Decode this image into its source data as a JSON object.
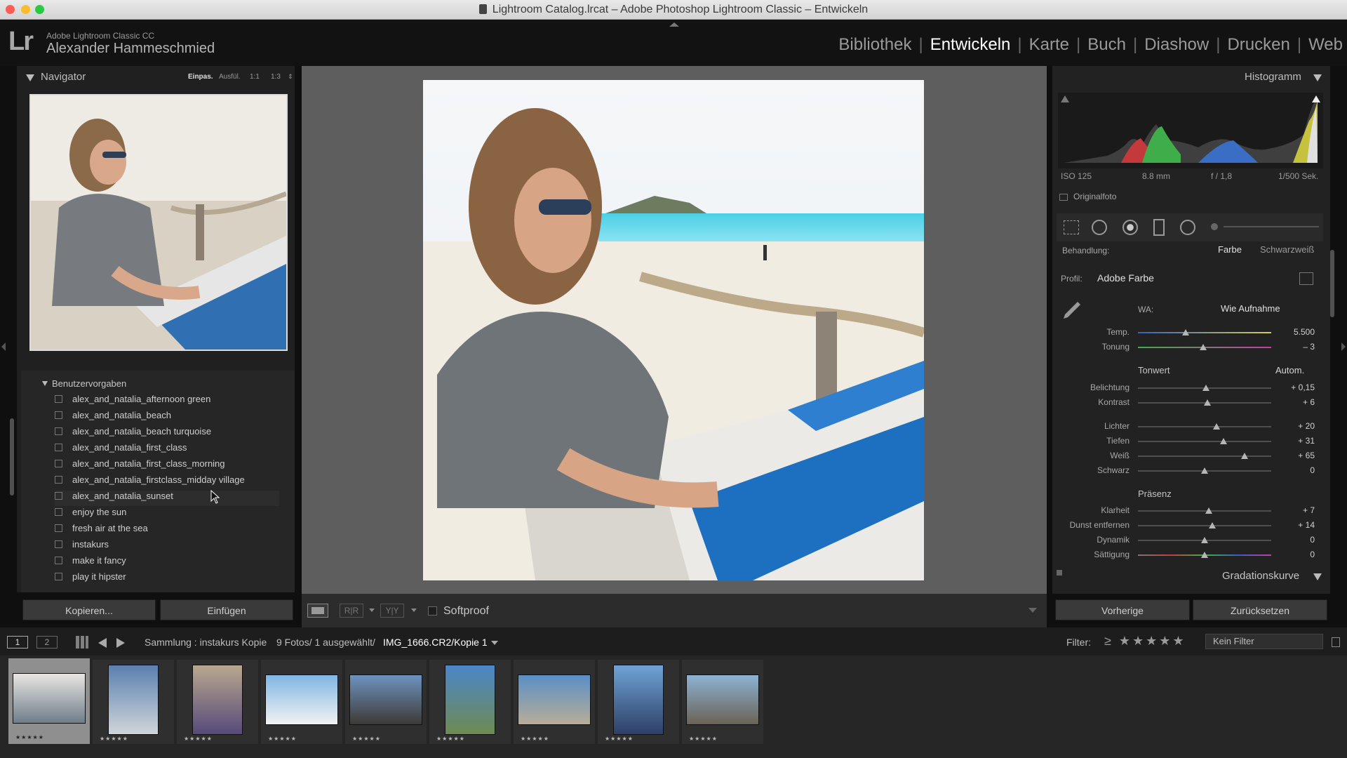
{
  "window": {
    "title": "Lightroom Catalog.lrcat – Adobe Photoshop Lightroom Classic – Entwickeln",
    "colors": {
      "close": "#fd5c58",
      "minimize": "#fdbc2e",
      "zoom": "#29c940"
    }
  },
  "identity": {
    "logo": "Lr",
    "product": "Adobe Lightroom Classic CC",
    "user": "Alexander Hammeschmied"
  },
  "modules": [
    {
      "label": "Bibliothek",
      "active": false
    },
    {
      "label": "Entwickeln",
      "active": true
    },
    {
      "label": "Karte",
      "active": false
    },
    {
      "label": "Buch",
      "active": false
    },
    {
      "label": "Diashow",
      "active": false
    },
    {
      "label": "Drucken",
      "active": false
    },
    {
      "label": "Web",
      "active": false
    }
  ],
  "navigator": {
    "title": "Navigator",
    "zoom_options": [
      "Einpas.",
      "Ausfül.",
      "1:1",
      "1:3"
    ]
  },
  "presets": {
    "group": "Benutzervorgaben",
    "items": [
      "alex_and_natalia_afternoon green",
      "alex_and_natalia_beach",
      "alex_and_natalia_beach turquoise",
      "alex_and_natalia_first_class",
      "alex_and_natalia_first_class_morning",
      "alex_and_natalia_firstclass_midday village",
      "alex_and_natalia_sunset",
      "enjoy the sun",
      "fresh air at the sea",
      "instakurs",
      "make it fancy",
      "play it hipster"
    ]
  },
  "left_buttons": {
    "copy": "Kopieren...",
    "paste": "Einfügen"
  },
  "toolbar": {
    "softproof": "Softproof"
  },
  "histogram": {
    "title": "Histogramm",
    "iso": "ISO 125",
    "focal": "8.8 mm",
    "aperture": "f / 1,8",
    "shutter": "1/500 Sek.",
    "original": "Originalfoto"
  },
  "basic": {
    "treatment_label": "Behandlung:",
    "treatment_color": "Farbe",
    "treatment_bw": "Schwarzweiß",
    "profile_label": "Profil:",
    "profile_value": "Adobe Farbe",
    "wb_label": "WA:",
    "wb_value": "Wie Aufnahme",
    "tonwert": "Tonwert",
    "auto": "Autom.",
    "praesenz": "Präsenz",
    "sliders": [
      {
        "label": "Temp.",
        "value": "5.500",
        "pos": 0.36
      },
      {
        "label": "Tonung",
        "value": "– 3",
        "pos": 0.49
      },
      {
        "label": "Belichtung",
        "value": "+ 0,15",
        "pos": 0.51
      },
      {
        "label": "Kontrast",
        "value": "+ 6",
        "pos": 0.52
      },
      {
        "label": "Lichter",
        "value": "+ 20",
        "pos": 0.59
      },
      {
        "label": "Tiefen",
        "value": "+ 31",
        "pos": 0.64
      },
      {
        "label": "Weiß",
        "value": "+ 65",
        "pos": 0.8
      },
      {
        "label": "Schwarz",
        "value": "0",
        "pos": 0.5
      },
      {
        "label": "Klarheit",
        "value": "+ 7",
        "pos": 0.53
      },
      {
        "label": "Dunst entfernen",
        "value": "+ 14",
        "pos": 0.56
      },
      {
        "label": "Dynamik",
        "value": "0",
        "pos": 0.5
      },
      {
        "label": "Sättigung",
        "value": "0",
        "pos": 0.5
      }
    ],
    "curve": "Gradationskurve"
  },
  "right_buttons": {
    "prev": "Vorherige",
    "reset": "Zurücksetzen"
  },
  "filmbar": {
    "screen1": "1",
    "screen2": "2",
    "source": "Sammlung : instakurs Kopie",
    "count": "9 Fotos/  1 ausgewählt/",
    "file": "IMG_1666.CR2/Kopie 1",
    "filter_label": "Filter:",
    "filter_value": "Kein Filter"
  },
  "filmstrip": {
    "rating": "★★★★★",
    "thumbs": [
      {
        "colors": [
          "#e8e6e1",
          "#6f7d8b"
        ]
      },
      {
        "colors": [
          "#5a7fb0",
          "#cfd6d9"
        ]
      },
      {
        "colors": [
          "#b9a88e",
          "#564a7a"
        ]
      },
      {
        "colors": [
          "#7fb6e4",
          "#f2f2f2"
        ]
      },
      {
        "colors": [
          "#6d93c0",
          "#3d3a35"
        ]
      },
      {
        "colors": [
          "#4b86c8",
          "#6f8a52"
        ]
      },
      {
        "colors": [
          "#5a8fc6",
          "#b8ad98"
        ]
      },
      {
        "colors": [
          "#6ea3d6",
          "#2e3f66"
        ]
      },
      {
        "colors": [
          "#8cb3d3",
          "#6b6255"
        ]
      }
    ]
  }
}
